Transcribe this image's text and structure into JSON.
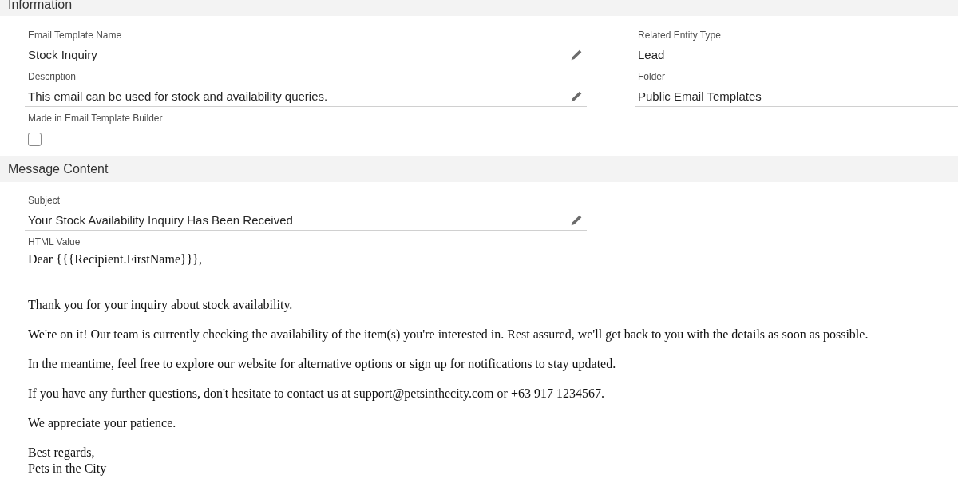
{
  "sections": [
    {
      "title": "Information",
      "columns": [
        [
          {
            "kind": "text",
            "label": "Email Template Name",
            "value": "Stock Inquiry",
            "editable": true
          },
          {
            "kind": "text",
            "label": "Description",
            "value": "This email can be used for stock and availability queries.",
            "editable": true
          },
          {
            "kind": "checkbox",
            "label": "Made in Email Template Builder",
            "checked": false,
            "editable": false
          }
        ],
        [
          {
            "kind": "text",
            "label": "Related Entity Type",
            "value": "Lead",
            "editable": false
          },
          {
            "kind": "text",
            "label": "Folder",
            "value": "Public Email Templates",
            "editable": false
          }
        ]
      ]
    },
    {
      "title": "Message Content",
      "columns": [
        [
          {
            "kind": "text",
            "label": "Subject",
            "value": "Your Stock Availability Inquiry Has Been Received",
            "editable": true
          },
          {
            "kind": "html",
            "label": "HTML Value",
            "greeting": "Dear {{{Recipient.FirstName}}},",
            "paragraphs": [
              "Thank you for your inquiry about stock availability.",
              "We're on it! Our team is currently checking the availability of the item(s) you're interested in. Rest assured, we'll get back to you with the details as soon as possible.",
              "In the meantime, feel free to explore our website for alternative options or sign up for notifications to stay updated.",
              "If you have any further questions, don't hesitate to contact us at support@petsinthecity.com or +63 917 1234567.",
              "We appreciate your patience."
            ],
            "signature": [
              "Best regards,",
              "Pets in the City"
            ]
          }
        ]
      ]
    }
  ]
}
